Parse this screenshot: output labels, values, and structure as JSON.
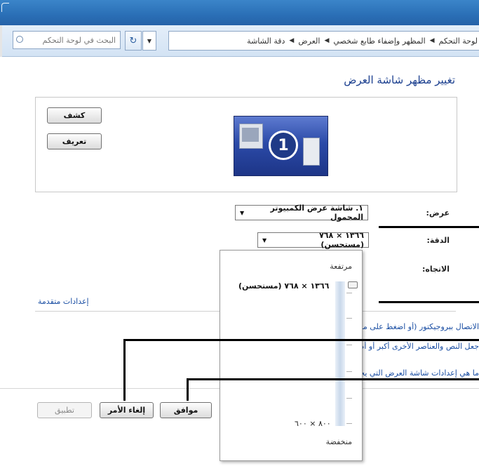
{
  "addressbar": {
    "breadcrumbs": [
      "لوحة التحكم",
      "المظهر وإضفاء طابع شخصي",
      "العرض",
      "دقة الشاشة"
    ],
    "search_placeholder": "البحث في لوحة التحكم"
  },
  "main": {
    "title": "تغيير مظهر شاشة العرض",
    "detect_button": "كشف",
    "identify_button": "تعريف",
    "monitor_number": "1",
    "display_label": "عرض:",
    "display_value": "١. شاشة عرض الكمبيوتر المحمول",
    "resolution_label": "الدقة:",
    "resolution_value": "١٣٦٦ × ٧٦٨ (مستحسن)",
    "orientation_label": "الاتجاه:",
    "advanced_link": "إعدادات متقدمة",
    "links": [
      "الاتصال ببروجيكتور (أو اضغط على مفتاح",
      "جعل النص والعناصر الأخرى أكبر أو أصغر",
      "ما هي إعدادات شاشة العرض التي يجب اختيارها؟"
    ]
  },
  "resolution_popup": {
    "high_label": "مرتفعة",
    "low_label": "منخفضة",
    "current_label": "١٣٦٦ × ٧٦٨ (مستحسن)",
    "min_label": "٨٠٠ × ٦٠٠",
    "slider_fraction": 1.0
  },
  "footer": {
    "ok_button": "موافق",
    "cancel_button": "إلغاء الأمر",
    "apply_button": "تطبيق"
  }
}
